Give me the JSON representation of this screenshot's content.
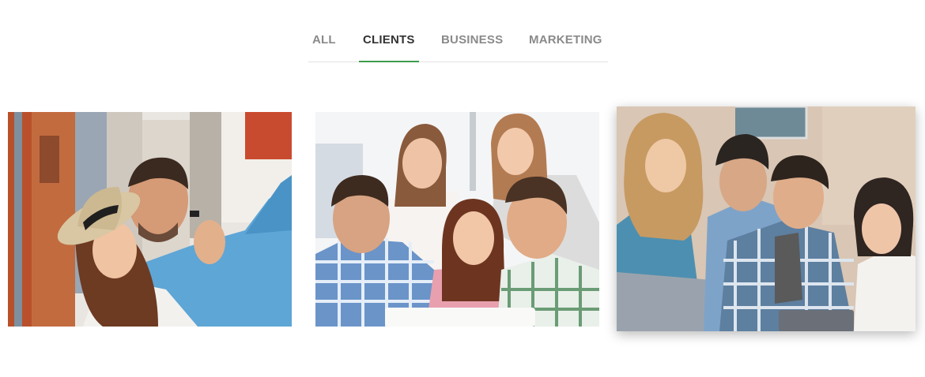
{
  "filters": {
    "tabs": [
      {
        "label": "ALL"
      },
      {
        "label": "CLIENTS",
        "active": true
      },
      {
        "label": "BUSINESS"
      },
      {
        "label": "MARKETING"
      }
    ],
    "accent_color": "#3d9b4c"
  },
  "gallery": {
    "items": [
      {
        "subject": "couple taking a selfie on a city street",
        "hovered": false
      },
      {
        "subject": "five colleagues looking at a laptop",
        "hovered": false
      },
      {
        "subject": "four young people looking at a tablet",
        "hovered": true
      }
    ]
  }
}
